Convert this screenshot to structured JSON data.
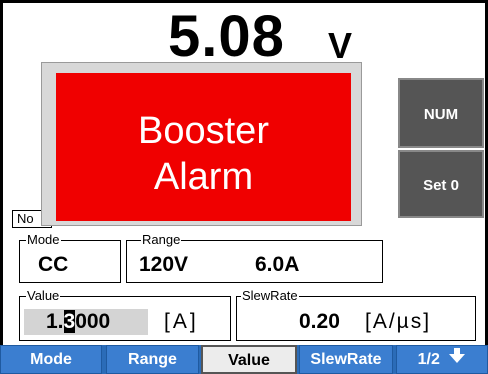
{
  "display": {
    "voltage_value": "5.08",
    "voltage_unit": "V"
  },
  "alarm": {
    "line1": "Booster",
    "line2": "Alarm"
  },
  "partial_label": "No",
  "side_buttons": {
    "num": "NUM",
    "set0": "Set 0"
  },
  "mode_group": {
    "legend": "Mode",
    "value": "CC"
  },
  "range_group": {
    "legend": "Range",
    "voltage": "120V",
    "current": "6.0A"
  },
  "value_group": {
    "legend": "Value",
    "pre_cursor": "1.",
    "cursor": "3",
    "post_cursor": "000",
    "unit": "[A]"
  },
  "slew_group": {
    "legend": "SlewRate",
    "value": "0.20",
    "unit": "[A/µs]"
  },
  "tabs": {
    "mode": "Mode",
    "range": "Range",
    "value": "Value",
    "slew": "SlewRate",
    "page": "1/2",
    "page_icon": "arrow-down-icon"
  },
  "colors": {
    "alarm_red": "#f00000",
    "tab_blue": "#3b7ed0",
    "side_button_gray": "#555555"
  }
}
